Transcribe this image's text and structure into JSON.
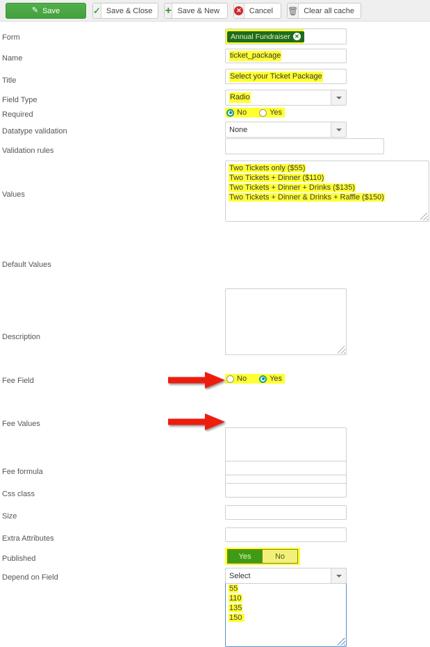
{
  "toolbar": {
    "buttons": [
      {
        "label": "Save",
        "icon": "pencil-square-icon"
      },
      {
        "label": "Save & Close",
        "icon": "check-icon"
      },
      {
        "label": "Save & New",
        "icon": "plus-icon"
      },
      {
        "label": "Cancel",
        "icon": "cancel-circle-icon"
      },
      {
        "label": "Clear all cache",
        "icon": "trash-icon"
      }
    ]
  },
  "form": {
    "labels": {
      "form": "Form",
      "name": "Name",
      "title": "Title",
      "field_type": "Field Type",
      "required": "Required",
      "datatype_validation": "Datatype validation",
      "validation_rules": "Validation rules",
      "values": "Values",
      "default_values": "Default Values",
      "description": "Description",
      "fee_field": "Fee Field",
      "fee_values": "Fee Values",
      "fee_formula": "Fee formula",
      "css_class": "Css class",
      "size": "Size",
      "extra_attributes": "Extra Attributes",
      "published": "Published",
      "depend_on_field": "Depend on Field"
    },
    "form_chip": "Annual Fundraiser",
    "form_chip_remove": "✕",
    "name_value": "ticket_package",
    "title_value": "Select your Ticket Package",
    "field_type_value": "Radio",
    "required": {
      "no": "No",
      "yes": "Yes",
      "selected": "No"
    },
    "datatype_validation_value": "None",
    "validation_rules_value": "",
    "values_lines": [
      "Two Tickets only ($55)",
      "Two Tickets + Dinner ($110)",
      "Two Tickets + Dinner + Drinks ($135)",
      "Two Tickets + Dinner & Drinks + Raffle ($150)"
    ],
    "default_values_value": "",
    "description_value": "",
    "fee_field": {
      "no": "No",
      "yes": "Yes",
      "selected": "Yes"
    },
    "fee_values_lines": [
      "55",
      "110",
      "135",
      "150"
    ],
    "fee_formula_value": "",
    "css_class_value": "",
    "size_value": "",
    "extra_attributes_value": "",
    "published": {
      "yes": "Yes",
      "no": "No",
      "selected": "Yes"
    },
    "depend_on_field_value": "Select"
  },
  "annotations": {
    "arrow_color": "#ee1d11",
    "arrows": [
      "fee-field-arrow",
      "fee-values-arrow"
    ]
  },
  "colors": {
    "highlight": "#ffff33",
    "primary_green": "#43a03c",
    "chip_green": "#1f6b1c",
    "focus_blue": "#5a8fc7",
    "toolbar_bg": "#efefef"
  }
}
